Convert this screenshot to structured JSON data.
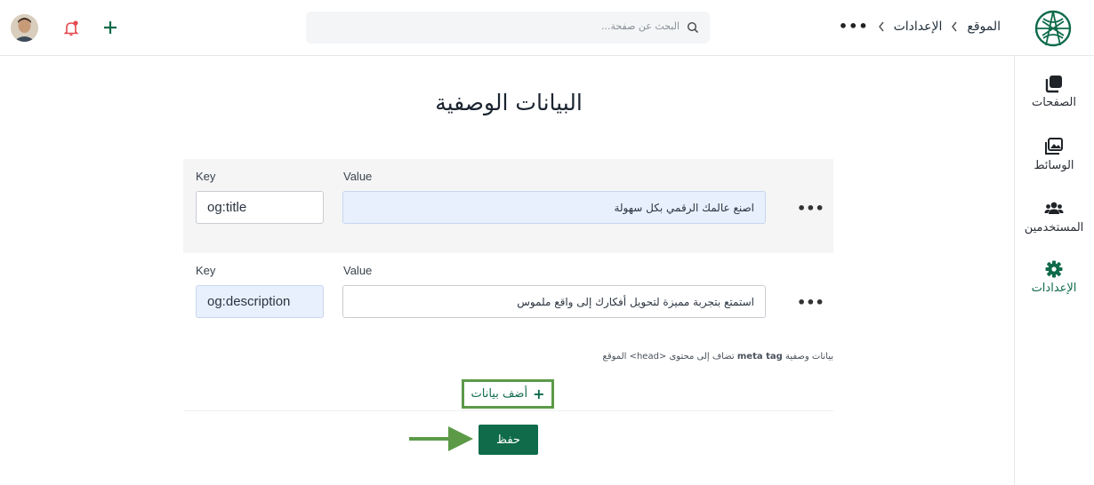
{
  "header": {
    "search_placeholder": "البحث عن صفحة...",
    "breadcrumb": [
      "الموقع",
      "الإعدادات"
    ],
    "more_label": "•••"
  },
  "sidebar": {
    "items": [
      {
        "label": "الصفحات",
        "icon": "pages-icon"
      },
      {
        "label": "الوسائط",
        "icon": "media-icon"
      },
      {
        "label": "المستخدمين",
        "icon": "users-icon"
      },
      {
        "label": "الإعدادات",
        "icon": "settings-icon",
        "active": true
      }
    ]
  },
  "main": {
    "title": "البيانات الوصفية",
    "rows": [
      {
        "key_label": "Key",
        "value_label": "Value",
        "key": "og:title",
        "value": "اصنع عالمك الرقمي بكل سهولة",
        "more": "•••"
      },
      {
        "key_label": "Key",
        "value_label": "Value",
        "key": "og:description",
        "value": "استمتع بتجربة مميزة لتحويل أفكارك إلى واقع ملموس",
        "more": "•••"
      }
    ],
    "hint_pre": "بيانات وصفية",
    "hint_tag": "meta tag",
    "hint_post": "تضاف إلى محتوى <head> الموقع",
    "add_label": "أضف بيانات",
    "add_plus": "+",
    "save_label": "حفظ"
  },
  "colors": {
    "brand": "#0f6b4a",
    "highlight_border": "#5c9a48",
    "focus_bg": "#e8f0fe",
    "notification": "#e5484d"
  }
}
